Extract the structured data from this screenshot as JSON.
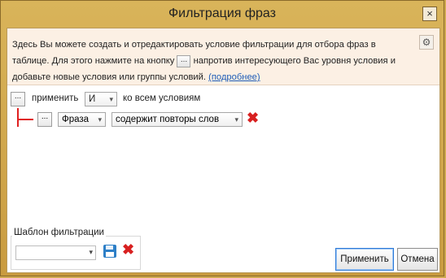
{
  "window": {
    "title": "Фильтрация фраз",
    "close_label": "×"
  },
  "info": {
    "text_part1": "Здесь Вы можете создать и отредактировать условие фильтрации для отбора фраз в таблице. Для этого нажмите на кнопку",
    "button_label": "...",
    "text_part2": "напротив интересующего Вас уровня условия и добавьте новые условия или группы условий.",
    "link_text": "(подробнее)",
    "settings_icon": "gear-icon"
  },
  "filter_root": {
    "menu_button": "...",
    "apply_label": "применить",
    "operator_value": "И",
    "suffix_label": "ко всем условиям"
  },
  "condition": {
    "menu_button": "...",
    "field_value": "Фраза",
    "operator_value": "содержит повторы слов",
    "delete_icon": "close-icon"
  },
  "template": {
    "label": "Шаблон фильтрации",
    "value": "",
    "save_icon": "save-icon",
    "delete_icon": "delete-icon"
  },
  "buttons": {
    "apply": "Применить",
    "cancel": "Отмена"
  },
  "colors": {
    "title_bar": "#d5ad52",
    "info_bg": "#fcf0e4",
    "link": "#1f5db7",
    "accent_red": "#d82020"
  }
}
